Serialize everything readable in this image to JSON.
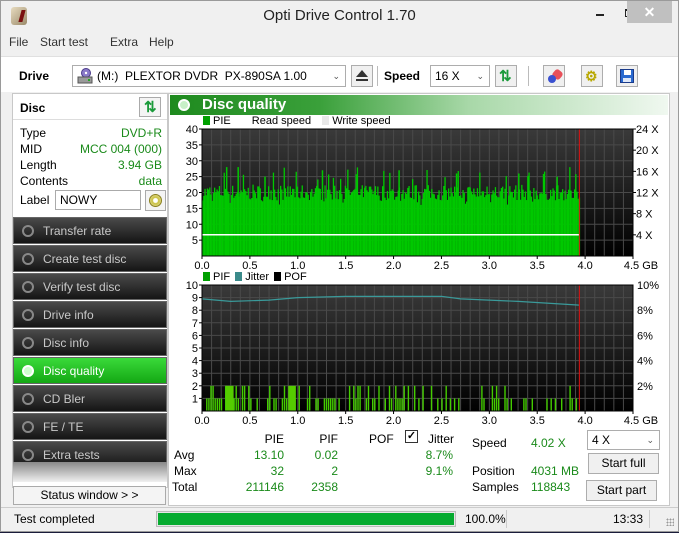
{
  "window": {
    "title": "Opti Drive Control 1.70",
    "controls": {
      "minimize": "—",
      "maximize": "☐",
      "close": "✕"
    }
  },
  "menu": [
    "File",
    "Start test",
    "Extra",
    "Help"
  ],
  "toolbar": {
    "drive_label": "Drive",
    "drive_value": "(M:)  PLEXTOR DVDR  PX-890SA 1.00",
    "speed_label": "Speed",
    "speed_value": "16 X",
    "icons": [
      "drive-icon",
      "eject-icon",
      "refresh-icon",
      "erase-icon",
      "settings-icon",
      "save-icon"
    ]
  },
  "disc": {
    "header": "Disc",
    "info": [
      {
        "key": "Type",
        "value": "DVD+R"
      },
      {
        "key": "MID",
        "value": "MCC 004 (000)"
      },
      {
        "key": "Length",
        "value": "3.94 GB"
      },
      {
        "key": "Contents",
        "value": "data"
      }
    ],
    "label_key": "Label",
    "label_value": "NOWY"
  },
  "nav": [
    {
      "label": "Transfer rate",
      "active": false
    },
    {
      "label": "Create test disc",
      "active": false
    },
    {
      "label": "Verify test disc",
      "active": false
    },
    {
      "label": "Drive info",
      "active": false
    },
    {
      "label": "Disc info",
      "active": false
    },
    {
      "label": "Disc quality",
      "active": true
    },
    {
      "label": "CD Bler",
      "active": false
    },
    {
      "label": "FE / TE",
      "active": false
    },
    {
      "label": "Extra tests",
      "active": false
    }
  ],
  "status_window_button": "Status window > >",
  "panel": {
    "title": "Disc quality"
  },
  "chart_data": [
    {
      "type": "bar",
      "name": "PIE chart",
      "legend": [
        {
          "label": "PIE",
          "color": "#00a000"
        },
        {
          "label": "Read speed",
          "color": "#ffffff"
        },
        {
          "label": "Write speed",
          "color": "#e8e8e8"
        }
      ],
      "x_ticks": [
        "0.0",
        "0.5",
        "1.0",
        "1.5",
        "2.0",
        "2.5",
        "3.0",
        "3.5",
        "4.0",
        "4.5 GB"
      ],
      "xlim": [
        0,
        4.5
      ],
      "y_ticks_left": [
        "5",
        "10",
        "15",
        "20",
        "25",
        "30",
        "35",
        "40"
      ],
      "ylim_left": [
        0,
        40
      ],
      "y_ticks_right": [
        "4 X",
        "8 X",
        "12 X",
        "16 X",
        "20 X",
        "24 X"
      ],
      "ylim_right": [
        0,
        24
      ],
      "data_end_gb": 3.94,
      "pie_typical": 20,
      "pie_max": 32,
      "pie_min_dip": 16,
      "read_speed_x": 4.02,
      "pie_color": "#00c800",
      "marker_color": "#e01010"
    },
    {
      "type": "bar",
      "name": "PIF chart",
      "legend": [
        {
          "label": "PIF",
          "color": "#00a000"
        },
        {
          "label": "Jitter",
          "color": "#3a8a8a"
        },
        {
          "label": "POF",
          "color": "#000000"
        }
      ],
      "x_ticks": [
        "0.0",
        "0.5",
        "1.0",
        "1.5",
        "2.0",
        "2.5",
        "3.0",
        "3.5",
        "4.0",
        "4.5 GB"
      ],
      "xlim": [
        0,
        4.5
      ],
      "y_ticks_left": [
        "1",
        "2",
        "3",
        "4",
        "5",
        "6",
        "7",
        "8",
        "9",
        "10"
      ],
      "ylim_left": [
        0,
        10
      ],
      "y_ticks_right": [
        "2%",
        "4%",
        "6%",
        "8%",
        "10%"
      ],
      "ylim_right": [
        0,
        10
      ],
      "data_end_gb": 3.94,
      "jitter_points": [
        [
          0,
          8.9
        ],
        [
          0.3,
          8.7
        ],
        [
          0.7,
          8.8
        ],
        [
          1.0,
          9.0
        ],
        [
          1.5,
          9.1
        ],
        [
          2.0,
          9.1
        ],
        [
          2.5,
          9.1
        ],
        [
          2.7,
          8.9
        ],
        [
          3.3,
          8.7
        ],
        [
          3.94,
          8.4
        ]
      ],
      "pif_color": "#44cc00",
      "jitter_color": "#3a9a9a",
      "marker_color": "#e01010"
    }
  ],
  "stats": {
    "columns": [
      "PIE",
      "PIF",
      "POF",
      "Jitter"
    ],
    "jitter_checked": true,
    "rows": [
      {
        "label": "Avg",
        "pie": "13.10",
        "pif": "0.02",
        "pof": "",
        "jitter": "8.7%"
      },
      {
        "label": "Max",
        "pie": "32",
        "pif": "2",
        "pof": "",
        "jitter": "9.1%"
      },
      {
        "label": "Total",
        "pie": "211146",
        "pif": "2358",
        "pof": "",
        "jitter": ""
      }
    ]
  },
  "run": {
    "speed_label": "Speed",
    "speed_value": "4.02 X",
    "position_label": "Position",
    "position_value": "4031 MB",
    "samples_label": "Samples",
    "samples_value": "118843",
    "speed_select": "4 X",
    "start_full": "Start full",
    "start_part": "Start part"
  },
  "statusbar": {
    "text": "Test completed",
    "progress": 100.0,
    "progress_text": "100.0%",
    "time": "13:33"
  }
}
